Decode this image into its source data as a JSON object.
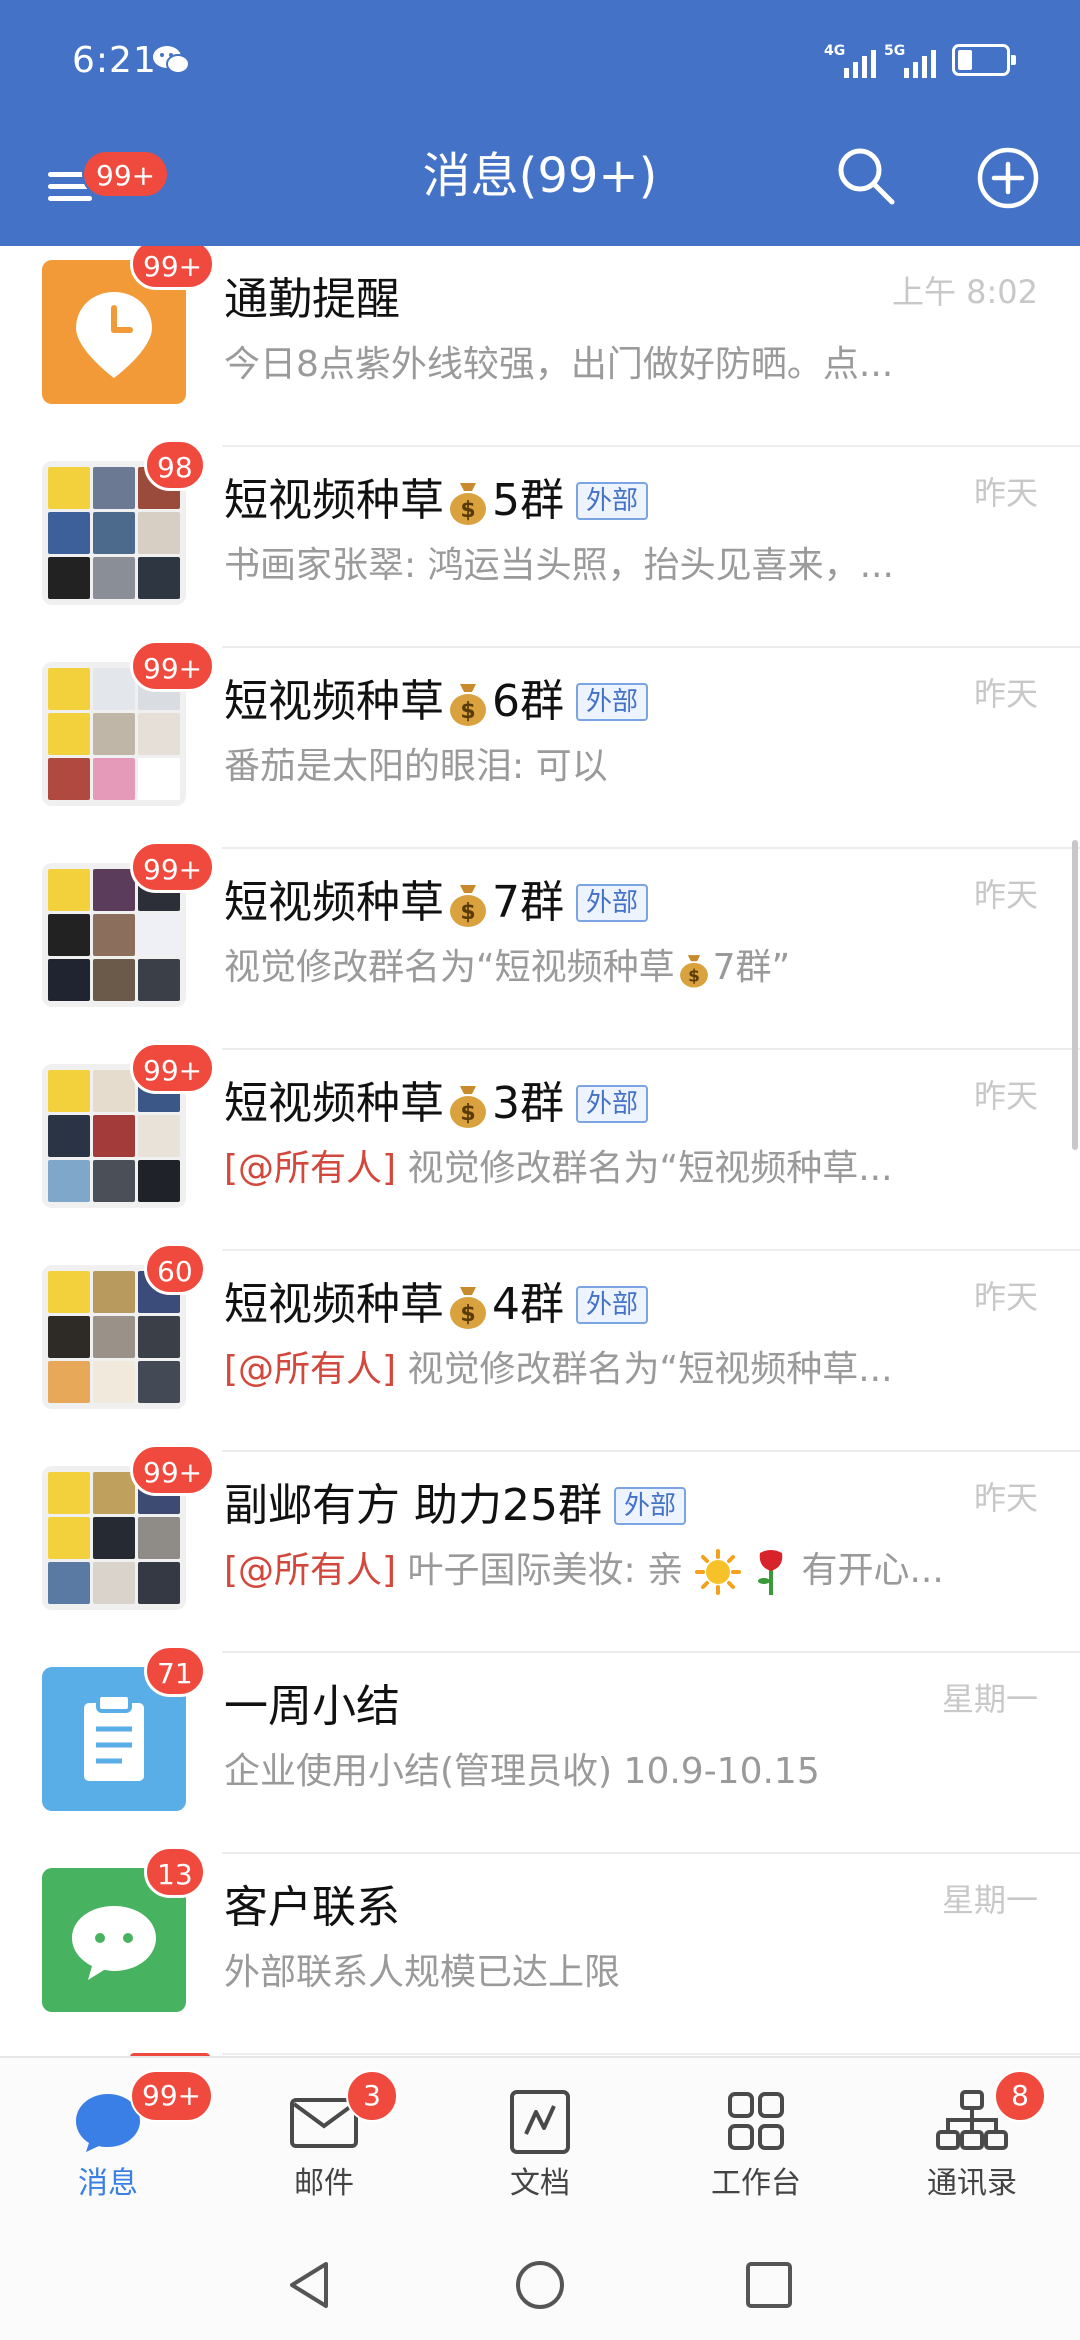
{
  "status_bar": {
    "time": "6:21",
    "net_1": "4G",
    "net_2": "5G"
  },
  "header": {
    "title": "消息(99+)",
    "menu_badge": "99+",
    "background_color": "#4372c7"
  },
  "messages": [
    {
      "title": "通勤提醒",
      "time": "上午 8:02",
      "preview": "今日8点紫外线较强，出门做好防晒。点...",
      "badge": "99+",
      "avatar_icon": "clock-pin-icon"
    },
    {
      "title_prefix": "短视频种草",
      "title_suffix": "5群",
      "tag": "外部",
      "time": "昨天",
      "preview": "书画家张翠: 鸿运当头照，抬头见喜来，...",
      "badge": "98",
      "avatar_icon": "group-avatar-grid"
    },
    {
      "title_prefix": "短视频种草",
      "title_suffix": "6群",
      "tag": "外部",
      "time": "昨天",
      "preview": "番茄是太阳的眼泪: 可以",
      "badge": "99+",
      "avatar_icon": "group-avatar-grid"
    },
    {
      "title_prefix": "短视频种草",
      "title_suffix": "7群",
      "tag": "外部",
      "time": "昨天",
      "preview_prefix": "视觉修改群名为“短视频种草",
      "preview_suffix": "7群”",
      "badge": "99+",
      "avatar_icon": "group-avatar-grid"
    },
    {
      "title_prefix": "短视频种草",
      "title_suffix": "3群",
      "tag": "外部",
      "time": "昨天",
      "mention": "[@所有人]",
      "preview": " 视觉修改群名为“短视频种草...",
      "badge": "99+",
      "avatar_icon": "group-avatar-grid"
    },
    {
      "title_prefix": "短视频种草",
      "title_suffix": "4群",
      "tag": "外部",
      "time": "昨天",
      "mention": "[@所有人]",
      "preview": " 视觉修改群名为“短视频种草...",
      "badge": "60",
      "avatar_icon": "group-avatar-grid"
    },
    {
      "title": "副邺有方 助力25群",
      "tag": "外部",
      "time": "昨天",
      "mention": "[@所有人]",
      "preview_prefix": " 叶子国际美妆: 亲",
      "preview_suffix": "有开心...",
      "badge": "99+",
      "avatar_icon": "group-avatar-grid"
    },
    {
      "title": "一周小结",
      "time": "星期一",
      "preview": "企业使用小结(管理员收) 10.9-10.15",
      "badge": "71",
      "avatar_icon": "clipboard-icon"
    },
    {
      "title": "客户联系",
      "time": "星期一",
      "preview": "外部联系人规模已达上限",
      "badge": "13",
      "avatar_icon": "chat-bubble-icon"
    }
  ],
  "bottom_nav": [
    {
      "label": "消息",
      "badge": "99+",
      "icon": "message-bubble-icon",
      "active": true
    },
    {
      "label": "邮件",
      "badge": "3",
      "icon": "mail-icon",
      "active": false
    },
    {
      "label": "文档",
      "badge": "",
      "icon": "document-icon",
      "active": false
    },
    {
      "label": "工作台",
      "badge": "",
      "icon": "grid-icon",
      "active": false
    },
    {
      "label": "通讯录",
      "badge": "8",
      "icon": "org-chart-icon",
      "active": false
    }
  ],
  "colors": {
    "accent_blue": "#4372c7",
    "badge_red": "#f04a3e",
    "mention_red": "#d3483c",
    "active_tab": "#3a7fe6"
  }
}
